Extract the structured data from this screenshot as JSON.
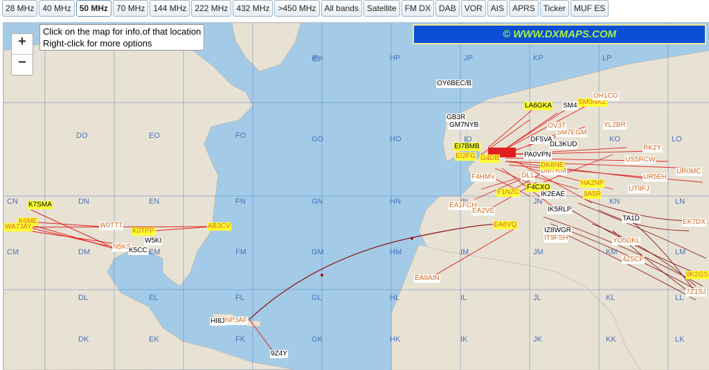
{
  "tabs": [
    "28 MHz",
    "40 MHz",
    "50 MHz",
    "70 MHz",
    "144 MHz",
    "222 MHz",
    "432 MHz",
    ">450 MHz",
    "All bands",
    "Satellite",
    "FM DX",
    "DAB",
    "VOR",
    "AIS",
    "APRS",
    "Ticker",
    "MUF ES"
  ],
  "active_tab": "50 MHz",
  "zoom": {
    "plus": "+",
    "minus": "−"
  },
  "info": {
    "line1": "Click on the map for info.of that location",
    "line2": "Right-click for more options"
  },
  "brand": "© WWW.DXMAPS.COM",
  "grid_squares": [
    "IP",
    "JP",
    "KP",
    "LP",
    "GP",
    "HP",
    "DO",
    "EO",
    "FO",
    "GO",
    "HO",
    "IO",
    "JO",
    "KO",
    "LO",
    "CN",
    "DN",
    "EN",
    "FN",
    "GN",
    "HN",
    "IN",
    "JN",
    "KN",
    "LN",
    "CM",
    "DM",
    "EM",
    "FM",
    "GM",
    "HM",
    "IM",
    "JM",
    "KM",
    "LM",
    "DL",
    "EL",
    "FL",
    "GL",
    "HL",
    "IL",
    "JL",
    "KL",
    "LL",
    "DK",
    "EK",
    "FK",
    "GK",
    "HK",
    "IK",
    "JK",
    "KK",
    "LK"
  ],
  "stations": [
    "OY6BEC/B",
    "LA6GKA",
    "SM4",
    "SM0NKZ",
    "OH1CO",
    "GB3R",
    "GM7NYB",
    "EI7BMB",
    "G4DB",
    "DF5VA",
    "DL3KUD",
    "PA0VPN",
    "F1NZC",
    "F4CXO",
    "IK2EAE",
    "IK5RLP",
    "IZ8WGR",
    "IT9FSH",
    "TA1D",
    "F4HMV",
    "EA1FCH",
    "EA2VE",
    "EA6VQ",
    "EA8AIN",
    "HI8J",
    "NP3AF",
    "9Z4Y",
    "K7SMA",
    "K6ME",
    "WA7JAY",
    "W0TTT",
    "N5KS",
    "K5CC",
    "W5KI",
    "K0TPP",
    "AB3CV",
    "YL2BR",
    "RK2Y",
    "US5RCW",
    "UR5EH",
    "UR0MC",
    "UT9FJ",
    "EK7DX",
    "9K2GS",
    "7Z1SJ",
    "4Z5CP",
    "YO5DKL",
    "9A5R",
    "HA2NP",
    "DM7RM",
    "DK8NE",
    "DL1",
    "EI2FG",
    "SM7EGM",
    "OV3T"
  ]
}
